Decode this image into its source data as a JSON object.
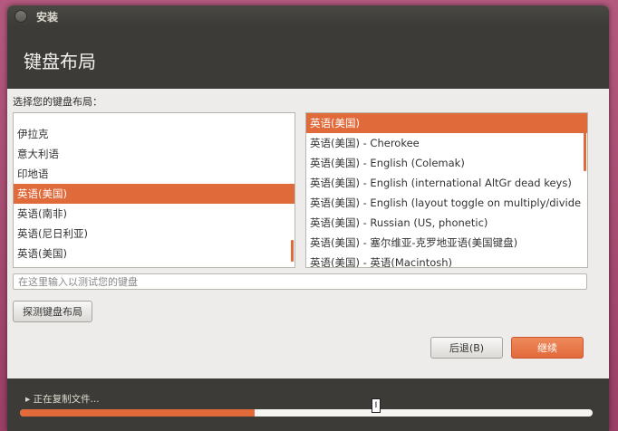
{
  "window": {
    "title": "安装"
  },
  "header": {
    "title": "键盘布局"
  },
  "prompt": "选择您的键盘布局：",
  "layouts": [
    {
      "label": "伊拉克",
      "selected": false
    },
    {
      "label": "意大利语",
      "selected": false
    },
    {
      "label": "印地语",
      "selected": false
    },
    {
      "label": "英语(美国)",
      "selected": true
    },
    {
      "label": "英语(南非)",
      "selected": false
    },
    {
      "label": "英语(尼日利亚)",
      "selected": false
    },
    {
      "label": "英语(美国)",
      "selected": false
    }
  ],
  "variants": [
    {
      "label": "英语(美国)",
      "selected": true
    },
    {
      "label": "英语(美国) - Cherokee",
      "selected": false
    },
    {
      "label": "英语(美国) - English (Colemak)",
      "selected": false
    },
    {
      "label": "英语(美国) - English (international AltGr dead keys)",
      "selected": false
    },
    {
      "label": "英语(美国) - English (layout toggle on multiply/divide",
      "selected": false
    },
    {
      "label": "英语(美国) - Russian (US, phonetic)",
      "selected": false
    },
    {
      "label": "英语(美国) - 塞尔维亚-克罗地亚语(美国键盘)",
      "selected": false
    },
    {
      "label": "英语(美国) - 英语(Macintosh)",
      "selected": false
    }
  ],
  "test_input": {
    "placeholder": "在这里输入以测试您的键盘"
  },
  "buttons": {
    "detect": "探测键盘布局",
    "back": "后退(B)",
    "continue": "继续"
  },
  "footer": {
    "status": "▸ 正在复制文件...",
    "progress": 0.41
  },
  "colors": {
    "accent": "#e16a3b",
    "header_bg": "#3c3b37"
  }
}
